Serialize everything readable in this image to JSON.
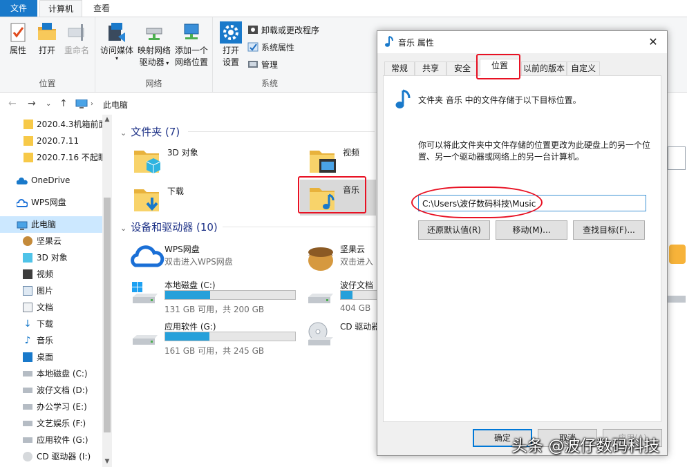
{
  "ribbon": {
    "tabs": {
      "file": "文件",
      "computer": "计算机",
      "view": "查看"
    },
    "groups": {
      "location": {
        "label": "位置",
        "properties": "属性",
        "open": "打开",
        "rename": "重命名"
      },
      "network": {
        "label": "网络",
        "access_media": "访问媒体",
        "map_drive_1": "映射网络",
        "map_drive_2": "驱动器",
        "add_location_1": "添加一个",
        "add_location_2": "网络位置"
      },
      "system": {
        "label": "系统",
        "open_settings_1": "打开",
        "open_settings_2": "设置",
        "uninstall": "卸载或更改程序",
        "system_props": "系统属性",
        "manage": "管理"
      }
    }
  },
  "address": {
    "path": "此电脑"
  },
  "nav": {
    "items": [
      {
        "label": "2020.4.3机箱前面"
      },
      {
        "label": "2020.7.11"
      },
      {
        "label": "2020.7.16 不起眼"
      },
      {
        "label": "OneDrive"
      },
      {
        "label": "WPS网盘"
      },
      {
        "label": "此电脑"
      },
      {
        "label": "坚果云"
      },
      {
        "label": "3D 对象"
      },
      {
        "label": "视频"
      },
      {
        "label": "图片"
      },
      {
        "label": "文档"
      },
      {
        "label": "下载"
      },
      {
        "label": "音乐"
      },
      {
        "label": "桌面"
      },
      {
        "label": "本地磁盘 (C:)"
      },
      {
        "label": "波仔文档 (D:)"
      },
      {
        "label": "办公学习 (E:)"
      },
      {
        "label": "文艺娱乐 (F:)"
      },
      {
        "label": "应用软件 (G:)"
      },
      {
        "label": "CD 驱动器 (I:)"
      }
    ]
  },
  "content": {
    "folders_header": "文件夹 (7)",
    "devices_header": "设备和驱动器 (10)",
    "folders": [
      {
        "name": "3D 对象"
      },
      {
        "name": "视频"
      },
      {
        "name": "下载"
      },
      {
        "name": "音乐"
      }
    ],
    "devices": {
      "wps": {
        "name": "WPS网盘",
        "sub": "双击进入WPS网盘"
      },
      "jianguo": {
        "name": "坚果云",
        "sub": "双击进入"
      },
      "c": {
        "name": "本地磁盘 (C:)",
        "free": "131 GB 可用，共 200 GB",
        "used_fraction": 0.345
      },
      "d": {
        "name": "波仔文档",
        "free": "404 GB",
        "used_fraction": 0.3
      },
      "g": {
        "name": "应用软件 (G:)",
        "free": "161 GB 可用，共 245 GB",
        "used_fraction": 0.343
      },
      "cd": {
        "name": "CD 驱动器"
      }
    }
  },
  "dialog": {
    "title": "音乐 属性",
    "tabs": [
      "常规",
      "共享",
      "安全",
      "位置",
      "以前的版本",
      "自定义"
    ],
    "text1": "文件夹 音乐 中的文件存储于以下目标位置。",
    "text2": "你可以将此文件夹中文件存储的位置更改为此硬盘上的另一个位置、另一个驱动器或网络上的另一台计算机。",
    "path": "C:\\Users\\波仔数码科技\\Music",
    "buttons": {
      "restore": "还原默认值(R)",
      "move": "移动(M)...",
      "find": "查找目标(F)..."
    },
    "footer": {
      "ok": "确定",
      "cancel": "取消",
      "apply": "应用(A)"
    }
  },
  "watermark": "头条 @波仔数码科技",
  "colors": {
    "accent": "#1979ca",
    "highlight": "#e81123",
    "drive_fill": "#26a0da"
  }
}
